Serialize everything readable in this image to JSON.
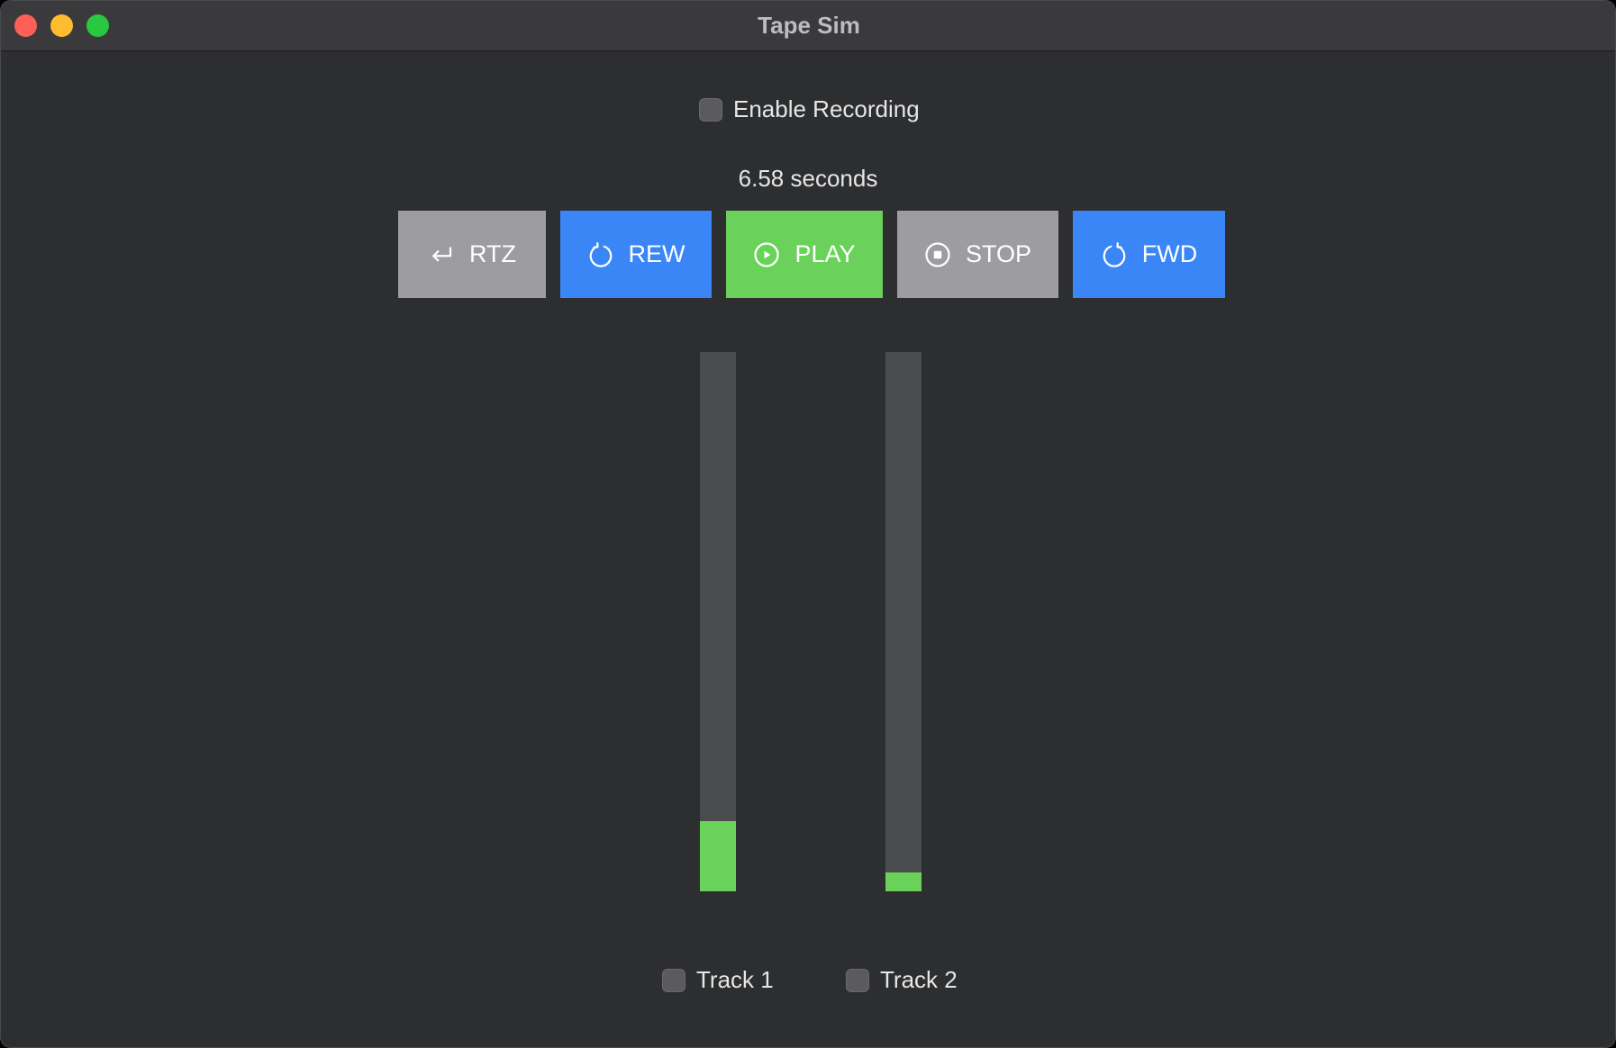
{
  "window": {
    "title": "Tape Sim"
  },
  "recording": {
    "label": "Enable Recording",
    "checked": false
  },
  "position": {
    "text": "6.58 seconds"
  },
  "transport": {
    "rtz": {
      "label": "RTZ",
      "icon": "return-icon",
      "color": "#9d9da1"
    },
    "rew": {
      "label": "REW",
      "icon": "refresh-ccw-icon",
      "color": "#3b86f7"
    },
    "play": {
      "label": "PLAY",
      "icon": "play-circle-icon",
      "color": "#6ad25a"
    },
    "stop": {
      "label": "STOP",
      "icon": "stop-circle-icon",
      "color": "#9d9da1"
    },
    "fwd": {
      "label": "FWD",
      "icon": "refresh-cw-icon",
      "color": "#3b86f7"
    }
  },
  "meters": [
    {
      "level": 0.13
    },
    {
      "level": 0.035
    }
  ],
  "tracks": [
    {
      "label": "Track 1",
      "checked": false
    },
    {
      "label": "Track 2",
      "checked": false
    }
  ],
  "colors": {
    "meter_fill": "#6ad25a",
    "meter_bg": "#4b4c4e",
    "window_bg": "#2d2e30"
  }
}
